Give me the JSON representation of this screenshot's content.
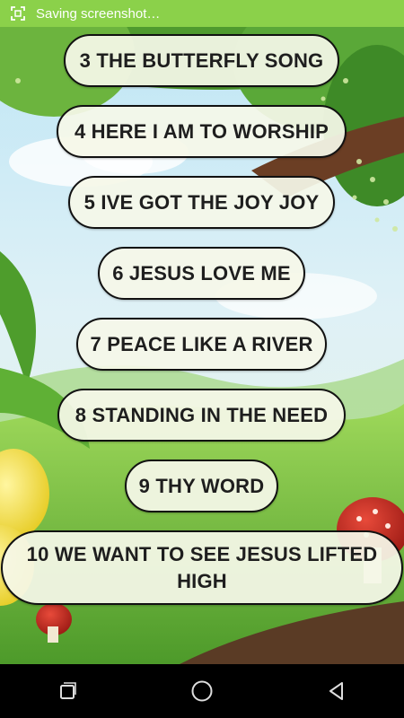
{
  "status_bar": {
    "text": "Saving screenshot…",
    "icon": "screenshot-icon"
  },
  "songs": [
    "3 THE BUTTERFLY SONG",
    "4 HERE I AM TO WORSHIP",
    "5 IVE GOT THE JOY JOY",
    "6 JESUS LOVE ME",
    "7 PEACE LIKE A RIVER",
    "8 STANDING IN THE NEED",
    "9 THY WORD",
    "10 WE WANT TO SEE JESUS LIFTED HIGH"
  ],
  "nav": {
    "icons": [
      "recents-icon",
      "home-icon",
      "back-icon"
    ]
  },
  "colors": {
    "status_bar": "#8bd14a",
    "button_bg": "#f5f8e8",
    "button_border": "#111111"
  }
}
